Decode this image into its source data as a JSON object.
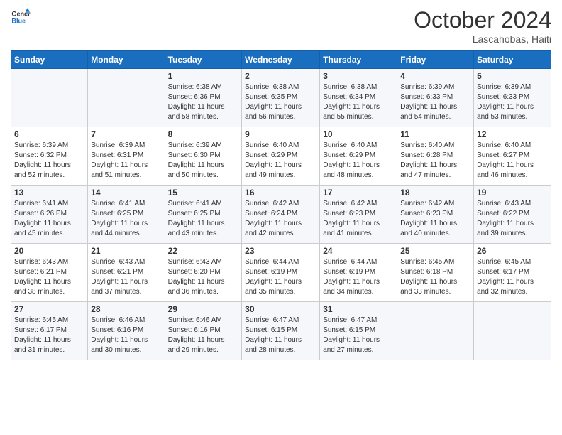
{
  "logo": {
    "line1": "General",
    "line2": "Blue"
  },
  "title": "October 2024",
  "location": "Lascahobas, Haiti",
  "weekdays": [
    "Sunday",
    "Monday",
    "Tuesday",
    "Wednesday",
    "Thursday",
    "Friday",
    "Saturday"
  ],
  "weeks": [
    [
      {
        "day": "",
        "info": ""
      },
      {
        "day": "",
        "info": ""
      },
      {
        "day": "1",
        "info": "Sunrise: 6:38 AM\nSunset: 6:36 PM\nDaylight: 11 hours\nand 58 minutes."
      },
      {
        "day": "2",
        "info": "Sunrise: 6:38 AM\nSunset: 6:35 PM\nDaylight: 11 hours\nand 56 minutes."
      },
      {
        "day": "3",
        "info": "Sunrise: 6:38 AM\nSunset: 6:34 PM\nDaylight: 11 hours\nand 55 minutes."
      },
      {
        "day": "4",
        "info": "Sunrise: 6:39 AM\nSunset: 6:33 PM\nDaylight: 11 hours\nand 54 minutes."
      },
      {
        "day": "5",
        "info": "Sunrise: 6:39 AM\nSunset: 6:33 PM\nDaylight: 11 hours\nand 53 minutes."
      }
    ],
    [
      {
        "day": "6",
        "info": "Sunrise: 6:39 AM\nSunset: 6:32 PM\nDaylight: 11 hours\nand 52 minutes."
      },
      {
        "day": "7",
        "info": "Sunrise: 6:39 AM\nSunset: 6:31 PM\nDaylight: 11 hours\nand 51 minutes."
      },
      {
        "day": "8",
        "info": "Sunrise: 6:39 AM\nSunset: 6:30 PM\nDaylight: 11 hours\nand 50 minutes."
      },
      {
        "day": "9",
        "info": "Sunrise: 6:40 AM\nSunset: 6:29 PM\nDaylight: 11 hours\nand 49 minutes."
      },
      {
        "day": "10",
        "info": "Sunrise: 6:40 AM\nSunset: 6:29 PM\nDaylight: 11 hours\nand 48 minutes."
      },
      {
        "day": "11",
        "info": "Sunrise: 6:40 AM\nSunset: 6:28 PM\nDaylight: 11 hours\nand 47 minutes."
      },
      {
        "day": "12",
        "info": "Sunrise: 6:40 AM\nSunset: 6:27 PM\nDaylight: 11 hours\nand 46 minutes."
      }
    ],
    [
      {
        "day": "13",
        "info": "Sunrise: 6:41 AM\nSunset: 6:26 PM\nDaylight: 11 hours\nand 45 minutes."
      },
      {
        "day": "14",
        "info": "Sunrise: 6:41 AM\nSunset: 6:25 PM\nDaylight: 11 hours\nand 44 minutes."
      },
      {
        "day": "15",
        "info": "Sunrise: 6:41 AM\nSunset: 6:25 PM\nDaylight: 11 hours\nand 43 minutes."
      },
      {
        "day": "16",
        "info": "Sunrise: 6:42 AM\nSunset: 6:24 PM\nDaylight: 11 hours\nand 42 minutes."
      },
      {
        "day": "17",
        "info": "Sunrise: 6:42 AM\nSunset: 6:23 PM\nDaylight: 11 hours\nand 41 minutes."
      },
      {
        "day": "18",
        "info": "Sunrise: 6:42 AM\nSunset: 6:23 PM\nDaylight: 11 hours\nand 40 minutes."
      },
      {
        "day": "19",
        "info": "Sunrise: 6:43 AM\nSunset: 6:22 PM\nDaylight: 11 hours\nand 39 minutes."
      }
    ],
    [
      {
        "day": "20",
        "info": "Sunrise: 6:43 AM\nSunset: 6:21 PM\nDaylight: 11 hours\nand 38 minutes."
      },
      {
        "day": "21",
        "info": "Sunrise: 6:43 AM\nSunset: 6:21 PM\nDaylight: 11 hours\nand 37 minutes."
      },
      {
        "day": "22",
        "info": "Sunrise: 6:43 AM\nSunset: 6:20 PM\nDaylight: 11 hours\nand 36 minutes."
      },
      {
        "day": "23",
        "info": "Sunrise: 6:44 AM\nSunset: 6:19 PM\nDaylight: 11 hours\nand 35 minutes."
      },
      {
        "day": "24",
        "info": "Sunrise: 6:44 AM\nSunset: 6:19 PM\nDaylight: 11 hours\nand 34 minutes."
      },
      {
        "day": "25",
        "info": "Sunrise: 6:45 AM\nSunset: 6:18 PM\nDaylight: 11 hours\nand 33 minutes."
      },
      {
        "day": "26",
        "info": "Sunrise: 6:45 AM\nSunset: 6:17 PM\nDaylight: 11 hours\nand 32 minutes."
      }
    ],
    [
      {
        "day": "27",
        "info": "Sunrise: 6:45 AM\nSunset: 6:17 PM\nDaylight: 11 hours\nand 31 minutes."
      },
      {
        "day": "28",
        "info": "Sunrise: 6:46 AM\nSunset: 6:16 PM\nDaylight: 11 hours\nand 30 minutes."
      },
      {
        "day": "29",
        "info": "Sunrise: 6:46 AM\nSunset: 6:16 PM\nDaylight: 11 hours\nand 29 minutes."
      },
      {
        "day": "30",
        "info": "Sunrise: 6:47 AM\nSunset: 6:15 PM\nDaylight: 11 hours\nand 28 minutes."
      },
      {
        "day": "31",
        "info": "Sunrise: 6:47 AM\nSunset: 6:15 PM\nDaylight: 11 hours\nand 27 minutes."
      },
      {
        "day": "",
        "info": ""
      },
      {
        "day": "",
        "info": ""
      }
    ]
  ]
}
